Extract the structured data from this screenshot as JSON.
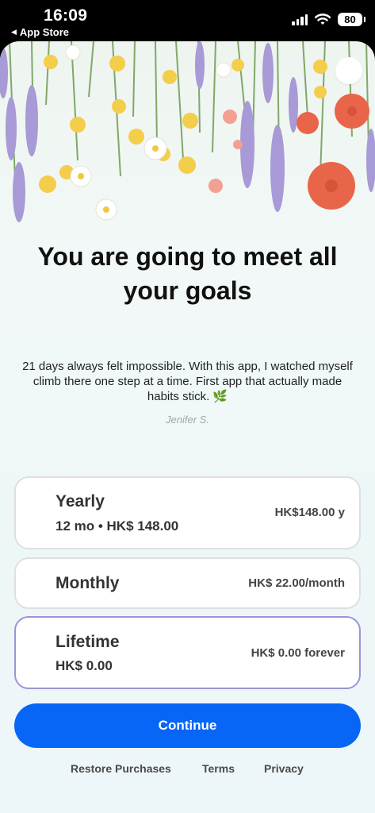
{
  "status_bar": {
    "time": "16:09",
    "back_label": "App Store",
    "battery": "80"
  },
  "headline": "You are going to meet all your goals",
  "testimonial": {
    "quote": "21 days always felt impossible. With this app, I watched myself climb there one step at a time. First app that actually made habits stick. 🌿",
    "author": "Jenifer S."
  },
  "plans": [
    {
      "name": "Yearly",
      "detail": "12 mo • HK$ 148.00",
      "price": "HK$148.00 y",
      "selected": false
    },
    {
      "name": "Monthly",
      "detail": "",
      "price": "HK$ 22.00/month",
      "selected": false
    },
    {
      "name": "Lifetime",
      "detail": "HK$ 0.00",
      "price": "HK$ 0.00 forever",
      "selected": true
    }
  ],
  "continue_label": "Continue",
  "footer": {
    "restore": "Restore Purchases",
    "terms": "Terms",
    "privacy": "Privacy"
  },
  "colors": {
    "accent": "#0766f6",
    "selected_border": "#9d93d6",
    "card_border": "#dedfe1"
  },
  "icons": {
    "close": "close-circle-icon",
    "back": "back-triangle-icon"
  }
}
